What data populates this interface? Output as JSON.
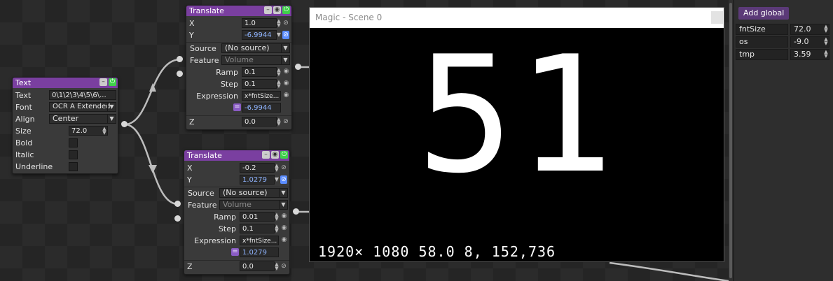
{
  "text_node": {
    "title": "Text",
    "rows": {
      "text_label": "Text",
      "text_value": "0\\1\\2\\3\\4\\5\\6\\...",
      "font_label": "Font",
      "font_value": "OCR A Extended",
      "align_label": "Align",
      "align_value": "Center",
      "size_label": "Size",
      "size_value": "72.0",
      "bold_label": "Bold",
      "italic_label": "Italic",
      "underline_label": "Underline"
    }
  },
  "translate_top": {
    "title": "Translate",
    "x_label": "X",
    "x_value": "1.0",
    "y_label": "Y",
    "y_value": "-6.9944",
    "source_label": "Source",
    "source_value": "(No source)",
    "feature_label": "Feature",
    "feature_value": "Volume",
    "ramp_label": "Ramp",
    "ramp_value": "0.1",
    "step_label": "Step",
    "step_value": "0.1",
    "expression_label": "Expression",
    "expression_value": "x*fntSize...",
    "result_value": "-6.9944",
    "z_label": "Z",
    "z_value": "0.0"
  },
  "translate_bottom": {
    "title": "Translate",
    "x_label": "X",
    "x_value": "-0.2",
    "y_label": "Y",
    "y_value": "1.0279",
    "source_label": "Source",
    "source_value": "(No source)",
    "feature_label": "Feature",
    "feature_value": "Volume",
    "ramp_label": "Ramp",
    "ramp_value": "0.01",
    "step_label": "Step",
    "step_value": "0.1",
    "expression_label": "Expression",
    "expression_value": "x*fntSize...",
    "result_value": "1.0279",
    "z_label": "Z",
    "z_value": "0.0"
  },
  "render_window": {
    "title": "Magic - Scene 0",
    "display_text": "51",
    "stats": "1920× 1080  58.0  8, 152,736"
  },
  "globals_panel": {
    "add_button": "Add global",
    "vars": [
      {
        "name": "fntSize",
        "value": "72.0"
      },
      {
        "name": "os",
        "value": "-9.0"
      },
      {
        "name": "tmp",
        "value": "3.59"
      }
    ]
  },
  "icons": {
    "minimize": "minus-icon",
    "eye": "eye-icon",
    "enable": "power-icon",
    "link": "link-icon",
    "spin": "spinner-arrows-icon",
    "dropdown": "chevron-down-icon"
  },
  "colors": {
    "node_header": "#7a3fa0",
    "enable_green": "#3fcf4a",
    "link_blue": "#5a8cff",
    "value_blue": "#8fb4ff"
  }
}
